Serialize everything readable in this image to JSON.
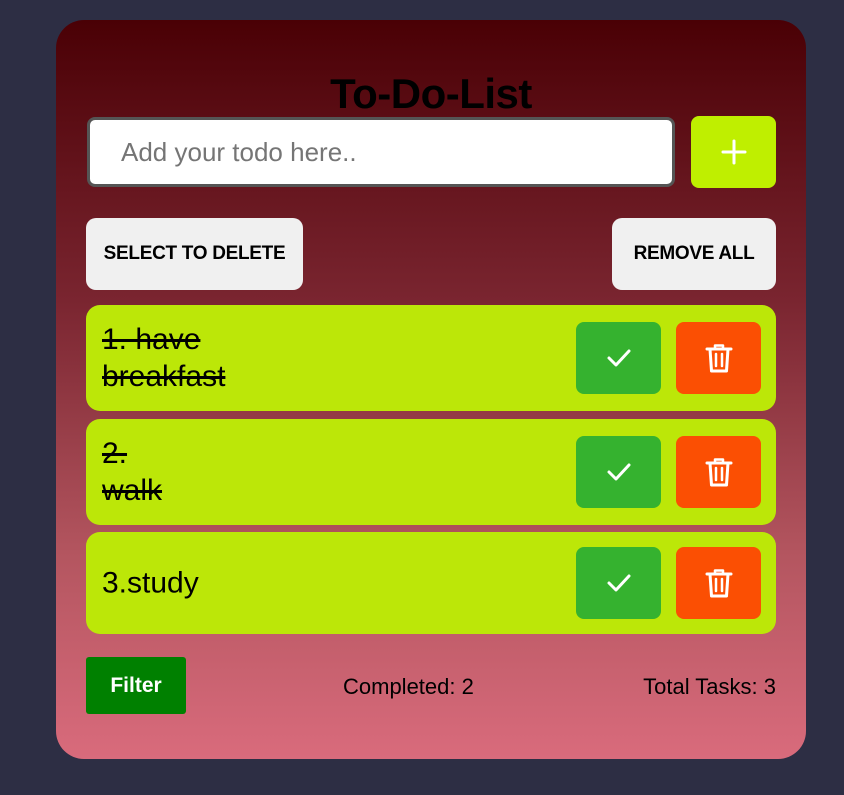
{
  "app": {
    "title": "To-Do-List"
  },
  "input": {
    "placeholder": "Add your todo here..",
    "value": ""
  },
  "add_button": {
    "icon": "plus-icon"
  },
  "actions": {
    "select_to_delete_label": "SELECT TO DELETE",
    "remove_all_label": "REMOVE ALL"
  },
  "todos": [
    {
      "line1": "1. have",
      "line2": "breakfast",
      "completed": true
    },
    {
      "line1": "2.",
      "line2": "walk",
      "completed": true
    },
    {
      "line1": "3.study",
      "line2": "",
      "completed": false
    }
  ],
  "footer": {
    "filter_label": "Filter",
    "completed_text": "Completed: 2",
    "total_text": "Total Tasks: 3"
  },
  "colors": {
    "page_background": "#2d2e44",
    "card_gradient_top": "#4a0005",
    "card_gradient_bottom": "#d96b7c",
    "accent_lime": "#bfef00",
    "todo_item": "#bce708",
    "check_button": "#35b22f",
    "delete_button": "#fb4f03",
    "filter_button": "#008000"
  }
}
